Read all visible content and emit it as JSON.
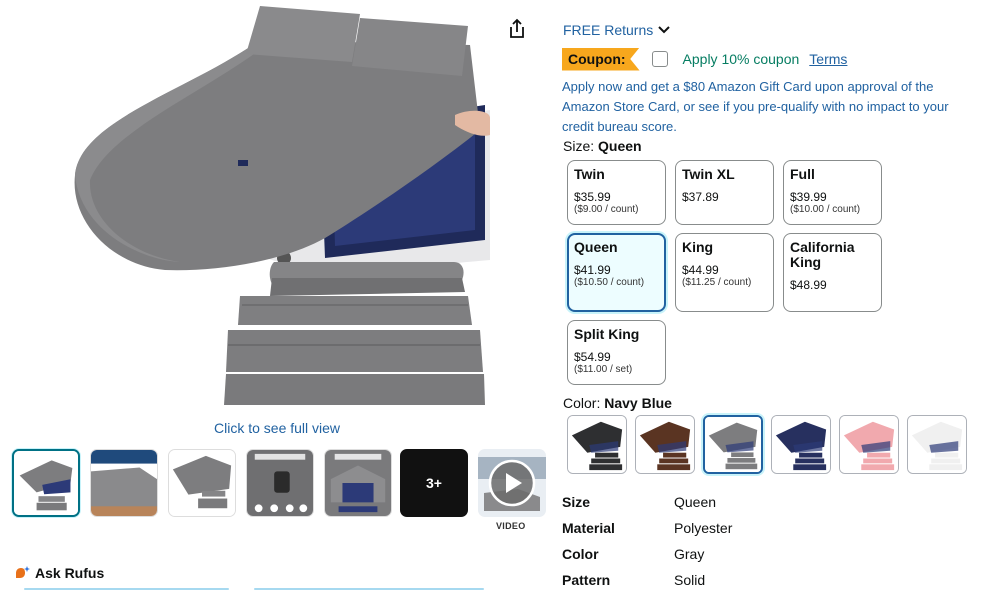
{
  "media": {
    "full_view_label": "Click to see full view",
    "thumbnails": [
      {
        "type": "image",
        "selected": true
      },
      {
        "type": "image",
        "selected": false
      },
      {
        "type": "image",
        "selected": false
      },
      {
        "type": "image",
        "selected": false
      },
      {
        "type": "image",
        "selected": false
      },
      {
        "type": "more",
        "label": "3+"
      },
      {
        "type": "video",
        "label": "VIDEO"
      }
    ]
  },
  "rufus": {
    "label": "Ask Rufus"
  },
  "buybox": {
    "free_returns": "FREE Returns",
    "coupon": {
      "badge": "Coupon:",
      "checkbox_label": "Apply 10% coupon",
      "terms": "Terms"
    },
    "promo_text": "Apply now and get a $80 Amazon Gift Card upon approval of the Amazon Store Card, or see if you pre-qualify with no impact to your credit bureau score.",
    "size": {
      "label": "Size:",
      "selected": "Queen",
      "options": [
        {
          "name": "Twin",
          "price": "$35.99",
          "unit": "($9.00 / count)"
        },
        {
          "name": "Twin XL",
          "price": "$37.89",
          "unit": ""
        },
        {
          "name": "Full",
          "price": "$39.99",
          "unit": "($10.00 / count)"
        },
        {
          "name": "Queen",
          "price": "$41.99",
          "unit": "($10.50 / count)"
        },
        {
          "name": "King",
          "price": "$44.99",
          "unit": "($11.25 / count)"
        },
        {
          "name": "California King",
          "price": "$48.99",
          "unit": ""
        },
        {
          "name": "Split King",
          "price": "$54.99",
          "unit": "($11.00 / set)"
        }
      ]
    },
    "color": {
      "label": "Color:",
      "selected": "Navy Blue",
      "swatches": [
        {
          "tone": "#2e2f31"
        },
        {
          "tone": "#5a3422"
        },
        {
          "tone": "#7d7d7f"
        },
        {
          "tone": "#27305f"
        },
        {
          "tone": "#f1a9ae"
        },
        {
          "tone": "#f0f0f0"
        }
      ]
    },
    "specs": [
      {
        "key": "Size",
        "value": "Queen"
      },
      {
        "key": "Material",
        "value": "Polyester"
      },
      {
        "key": "Color",
        "value": "Gray"
      },
      {
        "key": "Pattern",
        "value": "Solid"
      }
    ]
  },
  "colors": {
    "link": "#2162a1",
    "coupon_badge": "#f7a71d",
    "coupon_text": "#067d62",
    "selected_border": "#2162a1",
    "sheet_gray": "#7d7d7f"
  }
}
